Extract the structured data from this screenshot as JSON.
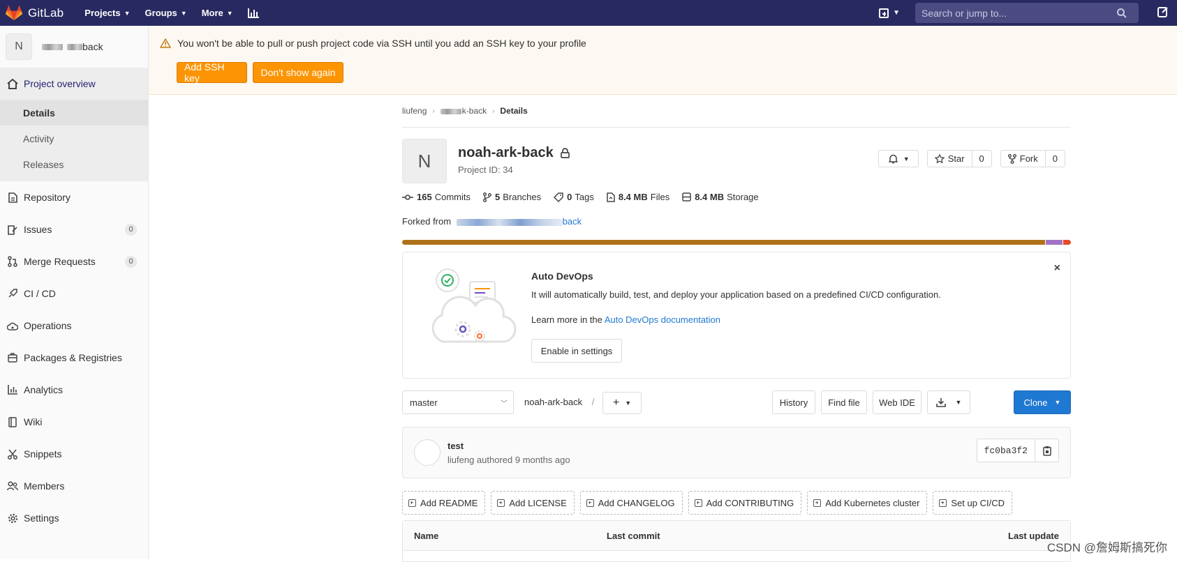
{
  "navbar": {
    "brand": "GitLab",
    "menu": [
      {
        "label": "Projects"
      },
      {
        "label": "Groups"
      },
      {
        "label": "More"
      }
    ],
    "search_placeholder": "Search or jump to..."
  },
  "sidebar": {
    "avatar_letter": "N",
    "project_name_suffix": "back",
    "sections": [
      {
        "label": "Project overview",
        "icon": "home-icon",
        "active": true
      },
      {
        "label": "Repository",
        "icon": "document-icon"
      },
      {
        "label": "Issues",
        "icon": "issues-icon",
        "count": "0"
      },
      {
        "label": "Merge Requests",
        "icon": "merge-request-icon",
        "count": "0"
      },
      {
        "label": "CI / CD",
        "icon": "rocket-icon"
      },
      {
        "label": "Operations",
        "icon": "cloud-gear-icon"
      },
      {
        "label": "Packages & Registries",
        "icon": "package-icon"
      },
      {
        "label": "Analytics",
        "icon": "chart-icon"
      },
      {
        "label": "Wiki",
        "icon": "book-icon"
      },
      {
        "label": "Snippets",
        "icon": "scissors-icon"
      },
      {
        "label": "Members",
        "icon": "users-icon"
      },
      {
        "label": "Settings",
        "icon": "gear-icon"
      }
    ],
    "sub_items": [
      {
        "label": "Details",
        "active": true
      },
      {
        "label": "Activity"
      },
      {
        "label": "Releases"
      }
    ]
  },
  "alert": {
    "message": "You won't be able to pull or push project code via SSH until you add an SSH key to your profile",
    "add_key_label": "Add SSH key",
    "dismiss_label": "Don't show again"
  },
  "breadcrumb": {
    "owner": "liufeng",
    "project_suffix": "k-back",
    "current": "Details"
  },
  "project": {
    "avatar_letter": "N",
    "name": "noah-ark-back",
    "id_text": "Project ID: 34",
    "star_label": "Star",
    "star_count": "0",
    "fork_label": "Fork",
    "fork_count": "0",
    "stats": {
      "commits_count": "165",
      "commits_label": "Commits",
      "branches_count": "5",
      "branches_label": "Branches",
      "tags_count": "0",
      "tags_label": "Tags",
      "files_size": "8.4 MB",
      "files_label": "Files",
      "storage_size": "8.4 MB",
      "storage_label": "Storage"
    },
    "forked_prefix": "Forked from",
    "forked_link_suffix": "back",
    "languages": [
      {
        "color": "#b07219",
        "share": 0.963
      },
      {
        "color": "#a074c4",
        "share": 0.025
      },
      {
        "color": "#e34c26",
        "share": 0.012
      }
    ]
  },
  "devops": {
    "title": "Auto DevOps",
    "description": "It will automatically build, test, and deploy your application based on a predefined CI/CD configuration.",
    "learn_prefix": "Learn more in the",
    "learn_link": "Auto DevOps documentation",
    "enable_label": "Enable in settings",
    "close_glyph": "×"
  },
  "toolbar": {
    "branch": "master",
    "repo_path": "noah-ark-back",
    "path_sep": "/",
    "history_label": "History",
    "find_file_label": "Find file",
    "web_ide_label": "Web IDE",
    "clone_label": "Clone"
  },
  "commit": {
    "title": "test",
    "meta": "liufeng authored 9 months ago",
    "sha": "fc0ba3f2"
  },
  "quick_actions": [
    "Add README",
    "Add LICENSE",
    "Add CHANGELOG",
    "Add CONTRIBUTING",
    "Add Kubernetes cluster",
    "Set up CI/CD"
  ],
  "files_table": {
    "col_name": "Name",
    "col_last_commit": "Last commit",
    "col_last_update": "Last update"
  },
  "watermark": "CSDN @詹姆斯搞死你"
}
